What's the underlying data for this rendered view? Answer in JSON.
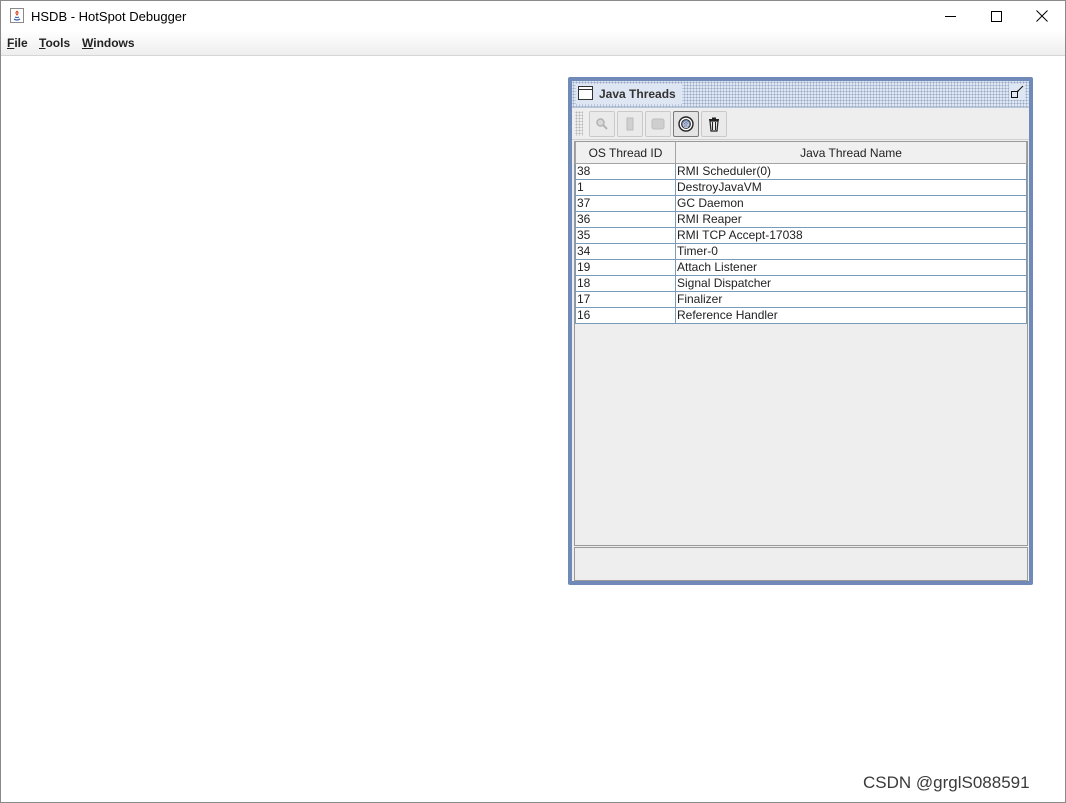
{
  "window": {
    "title": "HSDB - HotSpot Debugger",
    "controls": [
      "minimize",
      "maximize",
      "close"
    ]
  },
  "menu": [
    {
      "mnemonic": "F",
      "rest": "ile"
    },
    {
      "mnemonic": "T",
      "rest": "ools"
    },
    {
      "mnemonic": "W",
      "rest": "indows"
    }
  ],
  "java_threads": {
    "title": "Java Threads",
    "toolbar": [
      {
        "icon": "inspect-thread-icon",
        "enabled": false
      },
      {
        "icon": "stack-memory-icon",
        "enabled": false
      },
      {
        "icon": "thread-info-icon",
        "enabled": false
      },
      {
        "icon": "find-crashes-icon",
        "enabled": true,
        "active": true
      },
      {
        "icon": "trash-icon",
        "enabled": true
      }
    ],
    "columns": [
      "OS Thread ID",
      "Java Thread Name"
    ],
    "rows": [
      {
        "id": "38",
        "name": "RMI Scheduler(0)"
      },
      {
        "id": "1",
        "name": "DestroyJavaVM"
      },
      {
        "id": "37",
        "name": "GC Daemon"
      },
      {
        "id": "36",
        "name": "RMI Reaper"
      },
      {
        "id": "35",
        "name": "RMI TCP Accept-17038"
      },
      {
        "id": "34",
        "name": "Timer-0"
      },
      {
        "id": "19",
        "name": "Attach Listener"
      },
      {
        "id": "18",
        "name": "Signal Dispatcher"
      },
      {
        "id": "17",
        "name": "Finalizer"
      },
      {
        "id": "16",
        "name": "Reference Handler"
      }
    ]
  },
  "watermark": "CSDN @grglS088591"
}
